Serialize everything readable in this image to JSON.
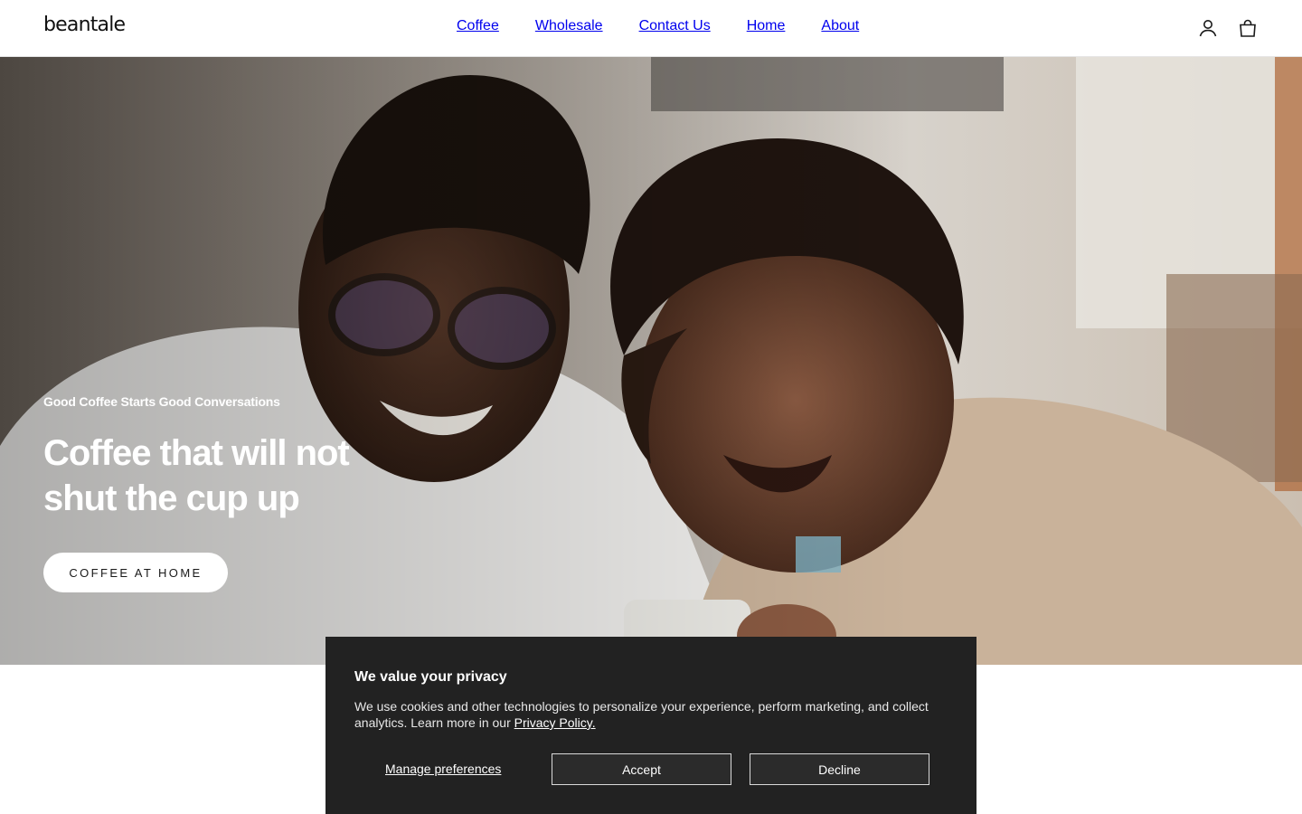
{
  "header": {
    "logo": "beantale",
    "nav": [
      {
        "label": "Coffee"
      },
      {
        "label": "Wholesale"
      },
      {
        "label": "Contact Us"
      },
      {
        "label": "Home"
      },
      {
        "label": "About"
      }
    ],
    "icons": {
      "account": "account-icon",
      "cart": "cart-icon"
    }
  },
  "hero": {
    "eyebrow": "Good Coffee Starts Good Conversations",
    "headline": "Coffee that will not shut the cup up",
    "cta_label": "COFFEE AT HOME"
  },
  "cookie_banner": {
    "title": "We value your privacy",
    "text": "We use cookies and other technologies to personalize your experience, perform marketing, and collect analytics. Learn more in our ",
    "policy_link": "Privacy Policy.",
    "manage_label": "Manage preferences",
    "accept_label": "Accept",
    "decline_label": "Decline"
  },
  "colors": {
    "banner_bg": "#222222",
    "cta_bg": "#ffffff",
    "text_dark": "#1a1a1a"
  }
}
